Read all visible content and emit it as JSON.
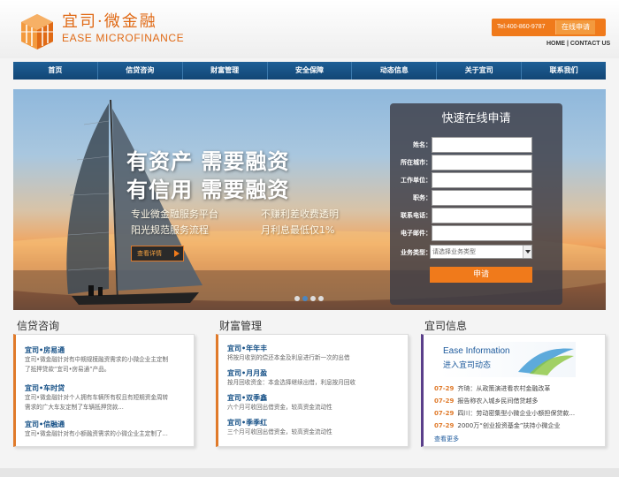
{
  "header": {
    "logo_cn": "宜司·微金融",
    "logo_en": "EASE MICROFINANCE",
    "tel": "Tel:400-860-9787",
    "apply_online": "在线申请",
    "top_links": "HOME | CONTACT US"
  },
  "nav": {
    "items": [
      "首页",
      "信贷咨询",
      "财富管理",
      "安全保障",
      "动态信息",
      "关于宜司",
      "联系我们"
    ]
  },
  "banner": {
    "slogan_line1": "有资产 需要融资",
    "slogan_line2": "有信用 需要融资",
    "sub1": "专业微金融服务平台",
    "sub2": "不赚利差收费透明",
    "sub3": "阳光规范服务流程",
    "sub4": "月利息最低仅1%",
    "detail_button": "查看详情",
    "slide_count": 4,
    "active_slide": 2
  },
  "form": {
    "title": "快速在线申请",
    "fields": [
      "姓名：",
      "所在城市：",
      "工作单位：",
      "职务：",
      "联系电话：",
      "电子邮件："
    ],
    "type_label": "业务类型：",
    "type_placeholder": "请选择业务类型",
    "submit": "申请"
  },
  "credit": {
    "title": "信贷咨询",
    "items": [
      {
        "title": "宜司•房易通",
        "desc1": "宜司•微金融针对有中期规模融资需求的小微企业主定制",
        "desc2": "了抵押贷款“宜司•房易通”产品。"
      },
      {
        "title": "宜司•车时贷",
        "desc1": "宜司•微金融针对个人拥有车辆所有权且有短期资金周转",
        "desc2": "需求的广大车友定制了车辆抵押贷款..."
      },
      {
        "title": "宜司•信融通",
        "desc1": "宜司•微金融针对有小额融资需求的小微企业主定制了...",
        "desc2": ""
      }
    ]
  },
  "wealth": {
    "title": "财富管理",
    "items": [
      {
        "title": "宜司•年年丰",
        "desc": "将按月收到的偿还本金及利息进行新一次的出借"
      },
      {
        "title": "宜司•月月盈",
        "desc": "按月回收资金：本金选择继续出借，利息按月回收"
      },
      {
        "title": "宜司•双季鑫",
        "desc": "六个月可收回出借资金，较高资金流动性"
      },
      {
        "title": "宜司•季季红",
        "desc": "三个月可收回出借资金，较高资金流动性"
      }
    ]
  },
  "news": {
    "title": "宜司信息",
    "banner_en": "Ease Information",
    "banner_cn": "进入宜司动态",
    "rows": [
      {
        "date": "07-29",
        "text": "齐琦：从政策演进看农村金融改革"
      },
      {
        "date": "07-29",
        "text": "报告称农入城乡民间借贷越多"
      },
      {
        "date": "07-29",
        "text": "四川：劳动密集型小微企业小额担保贷款..."
      },
      {
        "date": "07-29",
        "text": "2000万“创业投资基金”扶持小微企业"
      }
    ],
    "more": "查看更多"
  },
  "colors": {
    "accent": "#f07a1b",
    "nav": "#1a5589",
    "link": "#134e85"
  }
}
